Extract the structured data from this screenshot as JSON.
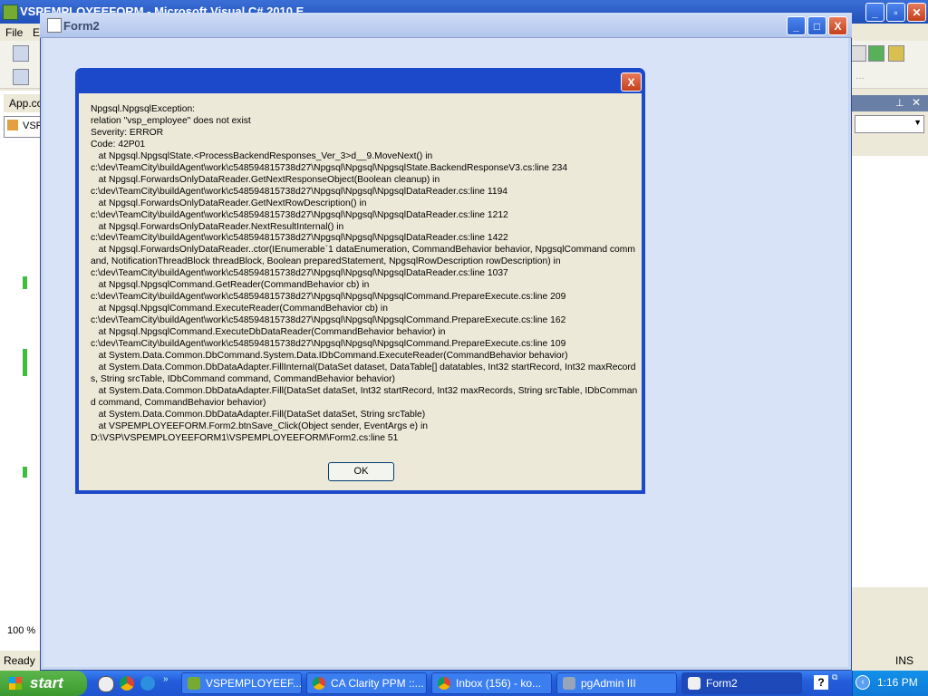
{
  "vs": {
    "title": "VSPEMPLOYEEFORM - Microsoft Visual C# 2010 E",
    "menu": [
      "File",
      "E"
    ],
    "left_tabs": [
      "App.co",
      "VSP"
    ],
    "zoom": "100 %",
    "status_ready": "Ready",
    "status_ins": "INS"
  },
  "form2": {
    "title": "Form2",
    "buttons": {
      "minimize": "_",
      "maximize": "□",
      "close": "X"
    }
  },
  "msgbox": {
    "close_label": "X",
    "text": "Npgsql.NpgsqlException:\nrelation \"vsp_employee\" does not exist\nSeverity: ERROR\nCode: 42P01\n   at Npgsql.NpgsqlState.<ProcessBackendResponses_Ver_3>d__9.MoveNext() in\nc:\\dev\\TeamCity\\buildAgent\\work\\c548594815738d27\\Npgsql\\Npgsql\\NpgsqlState.BackendResponseV3.cs:line 234\n   at Npgsql.ForwardsOnlyDataReader.GetNextResponseObject(Boolean cleanup) in\nc:\\dev\\TeamCity\\buildAgent\\work\\c548594815738d27\\Npgsql\\Npgsql\\NpgsqlDataReader.cs:line 1194\n   at Npgsql.ForwardsOnlyDataReader.GetNextRowDescription() in\nc:\\dev\\TeamCity\\buildAgent\\work\\c548594815738d27\\Npgsql\\Npgsql\\NpgsqlDataReader.cs:line 1212\n   at Npgsql.ForwardsOnlyDataReader.NextResultInternal() in\nc:\\dev\\TeamCity\\buildAgent\\work\\c548594815738d27\\Npgsql\\Npgsql\\NpgsqlDataReader.cs:line 1422\n   at Npgsql.ForwardsOnlyDataReader..ctor(IEnumerable`1 dataEnumeration, CommandBehavior behavior, NpgsqlCommand command, NotificationThreadBlock threadBlock, Boolean preparedStatement, NpgsqlRowDescription rowDescription) in\nc:\\dev\\TeamCity\\buildAgent\\work\\c548594815738d27\\Npgsql\\Npgsql\\NpgsqlDataReader.cs:line 1037\n   at Npgsql.NpgsqlCommand.GetReader(CommandBehavior cb) in\nc:\\dev\\TeamCity\\buildAgent\\work\\c548594815738d27\\Npgsql\\Npgsql\\NpgsqlCommand.PrepareExecute.cs:line 209\n   at Npgsql.NpgsqlCommand.ExecuteReader(CommandBehavior cb) in\nc:\\dev\\TeamCity\\buildAgent\\work\\c548594815738d27\\Npgsql\\Npgsql\\NpgsqlCommand.PrepareExecute.cs:line 162\n   at Npgsql.NpgsqlCommand.ExecuteDbDataReader(CommandBehavior behavior) in\nc:\\dev\\TeamCity\\buildAgent\\work\\c548594815738d27\\Npgsql\\Npgsql\\NpgsqlCommand.PrepareExecute.cs:line 109\n   at System.Data.Common.DbCommand.System.Data.IDbCommand.ExecuteReader(CommandBehavior behavior)\n   at System.Data.Common.DbDataAdapter.FillInternal(DataSet dataset, DataTable[] datatables, Int32 startRecord, Int32 maxRecords, String srcTable, IDbCommand command, CommandBehavior behavior)\n   at System.Data.Common.DbDataAdapter.Fill(DataSet dataSet, Int32 startRecord, Int32 maxRecords, String srcTable, IDbCommand command, CommandBehavior behavior)\n   at System.Data.Common.DbDataAdapter.Fill(DataSet dataSet, String srcTable)\n   at VSPEMPLOYEEFORM.Form2.btnSave_Click(Object sender, EventArgs e) in\nD:\\VSP\\VSPEMPLOYEEFORM1\\VSPEMPLOYEEFORM\\Form2.cs:line 51",
    "ok_label": "OK"
  },
  "taskbar": {
    "start_label": "start",
    "items": [
      "VSPEMPLOYEEF...",
      "CA Clarity PPM ::...",
      "Inbox (156) - ko...",
      "pgAdmin III",
      "Form2"
    ],
    "clock": "1:16 PM"
  },
  "colors": {
    "xp_blue": "#245edb",
    "form_bg": "#d8e3f7",
    "dialog_border": "#1c49c9",
    "dialog_bg": "#ece9d8"
  }
}
